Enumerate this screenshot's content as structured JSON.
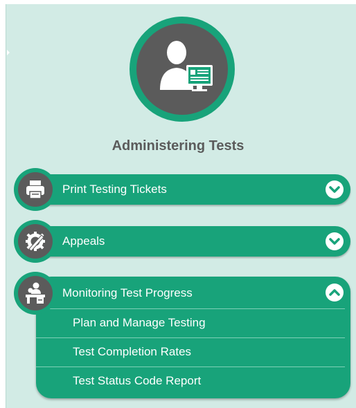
{
  "section": {
    "title": "Administering Tests",
    "hero_icon": "administrator-at-monitor-icon"
  },
  "menu": [
    {
      "label": "Print Testing Tickets",
      "icon": "printer-icon",
      "expanded": false
    },
    {
      "label": "Appeals",
      "icon": "gear-pencil-icon",
      "expanded": false
    },
    {
      "label": "Monitoring Test Progress",
      "icon": "proctor-desk-icon",
      "expanded": true,
      "subitems": [
        {
          "label": "Plan and Manage Testing"
        },
        {
          "label": "Test Completion Rates"
        },
        {
          "label": "Test Status Code Report"
        }
      ]
    }
  ],
  "colors": {
    "accent": "#18a37a",
    "icon_bg": "#5b5b5b",
    "panel_bg": "#d2ebe5",
    "title_text": "#5b5b5b"
  }
}
